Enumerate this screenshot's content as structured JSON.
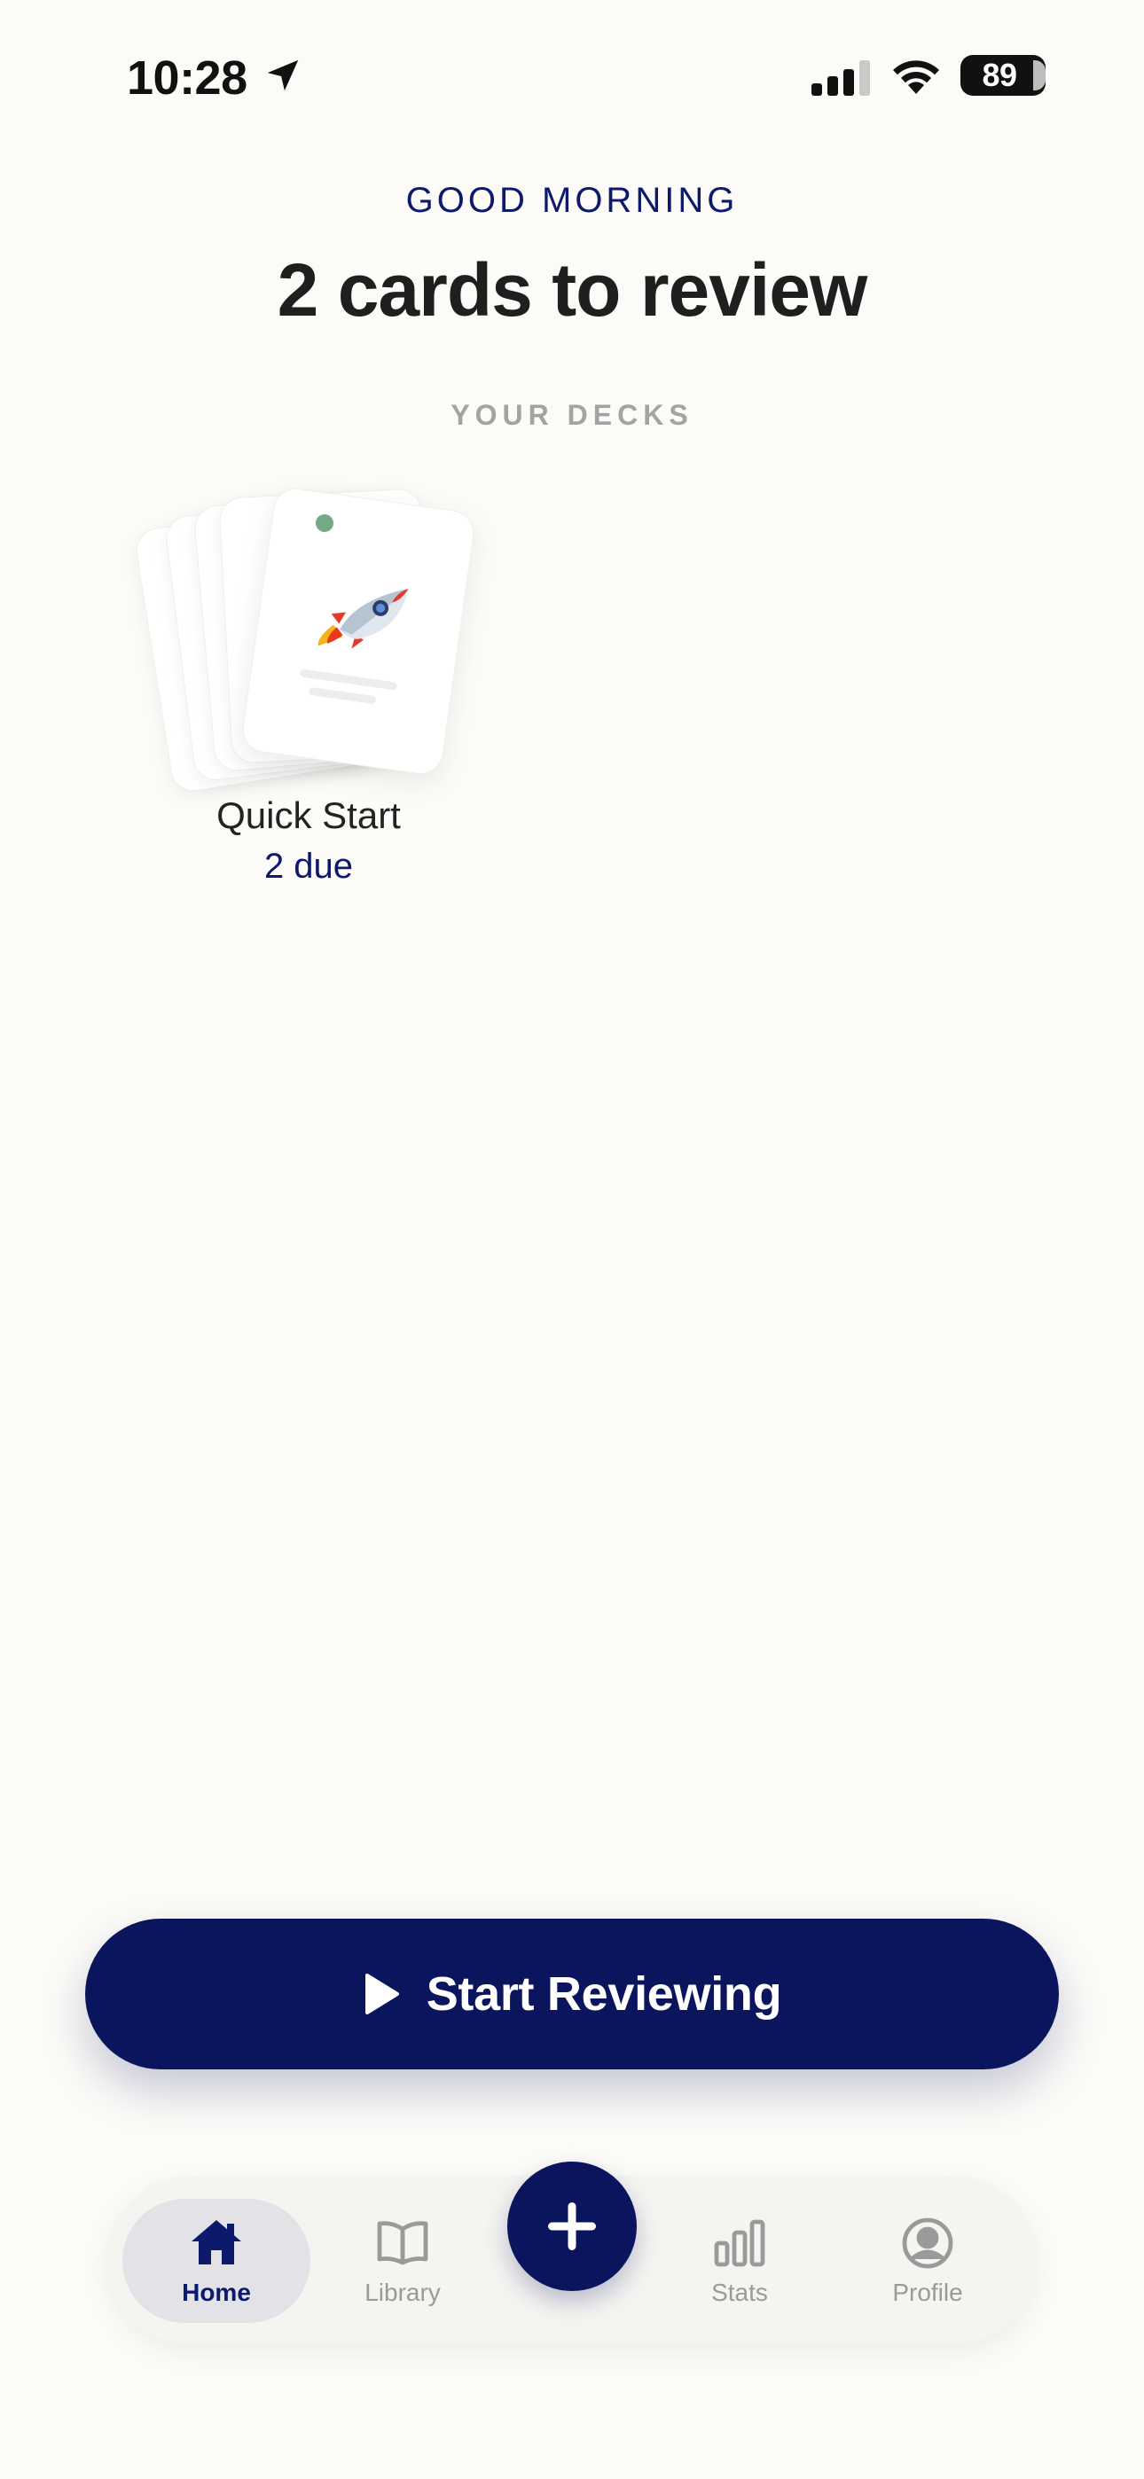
{
  "status_bar": {
    "time": "10:28",
    "battery": "89",
    "icons": [
      "location-arrow-icon",
      "cellular-signal-icon",
      "wifi-icon",
      "battery-icon"
    ]
  },
  "header": {
    "greeting": "GOOD MORNING",
    "headline": "2 cards to review"
  },
  "decks_section": {
    "label": "YOUR DECKS",
    "decks": [
      {
        "name": "Quick Start",
        "due": "2 due",
        "emoji": "rocket-icon",
        "status_color": "#76a886"
      }
    ]
  },
  "primary_action": {
    "label": "Start Reviewing",
    "icon": "play-icon"
  },
  "bottom_nav": {
    "items": [
      {
        "label": "Home",
        "icon": "home-icon",
        "active": true
      },
      {
        "label": "Library",
        "icon": "book-icon",
        "active": false
      },
      {
        "label": "Stats",
        "icon": "bar-chart-icon",
        "active": false
      },
      {
        "label": "Profile",
        "icon": "profile-icon",
        "active": false
      }
    ],
    "fab_icon": "plus-icon"
  },
  "colors": {
    "accent": "#0b155e",
    "background": "#fcfbf8",
    "muted": "#9a9a9a"
  }
}
